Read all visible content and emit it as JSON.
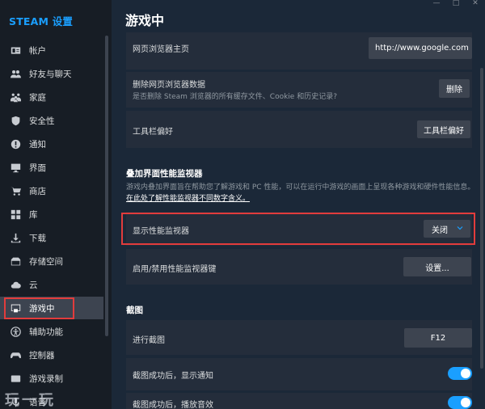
{
  "sidebar": {
    "title": "STEAM 设置",
    "items": [
      {
        "label": "帐户",
        "icon": "account-card-icon"
      },
      {
        "label": "好友与聊天",
        "icon": "friends-icon"
      },
      {
        "label": "家庭",
        "icon": "family-icon"
      },
      {
        "label": "安全性",
        "icon": "shield-icon"
      },
      {
        "label": "通知",
        "icon": "notification-icon"
      },
      {
        "label": "界面",
        "icon": "monitor-icon"
      },
      {
        "label": "商店",
        "icon": "cart-icon"
      },
      {
        "label": "库",
        "icon": "grid-icon"
      },
      {
        "label": "下载",
        "icon": "download-icon"
      },
      {
        "label": "存储空间",
        "icon": "storage-icon"
      },
      {
        "label": "云",
        "icon": "cloud-icon"
      },
      {
        "label": "游戏中",
        "icon": "in-game-icon"
      },
      {
        "label": "辅助功能",
        "icon": "accessibility-icon"
      },
      {
        "label": "控制器",
        "icon": "controller-icon"
      },
      {
        "label": "游戏录制",
        "icon": "recording-icon"
      },
      {
        "label": "语音",
        "icon": "voice-icon"
      }
    ],
    "active_index": 11
  },
  "watermark": "玩一玩",
  "main": {
    "title": "游戏中",
    "browser_home": {
      "label": "网页浏览器主页",
      "value": "http://www.google.com"
    },
    "delete_browser_data": {
      "label": "删除网页浏览器数据",
      "desc": "是否删除 Steam 浏览器的所有缓存文件、Cookie 和历史记录?",
      "button": "删除"
    },
    "toolbar_pref": {
      "label": "工具栏偏好",
      "button": "工具栏偏好"
    },
    "overlay_perf": {
      "heading": "叠加界面性能监视器",
      "desc": "游戏内叠加界面旨在帮助您了解游戏和 PC 性能，可以在运行中游戏的画面上呈现各种游戏和硬件性能信息。",
      "link": "在此处了解性能监视器不同数字含义。"
    },
    "show_monitor": {
      "label": "显示性能监视器",
      "value": "关闭"
    },
    "monitor_key": {
      "label": "启用/禁用性能监视器键",
      "button": "设置..."
    },
    "screenshot": {
      "heading": "截图",
      "take": {
        "label": "进行截图",
        "key": "F12"
      },
      "notify": {
        "label": "截图成功后，显示通知",
        "on": true
      },
      "sound": {
        "label": "截图成功后，播放音效",
        "on": true
      }
    }
  },
  "colors": {
    "accent": "#1a9fff",
    "highlight": "#e23c3c",
    "background": "#1b2838",
    "panel": "#242d3b"
  }
}
